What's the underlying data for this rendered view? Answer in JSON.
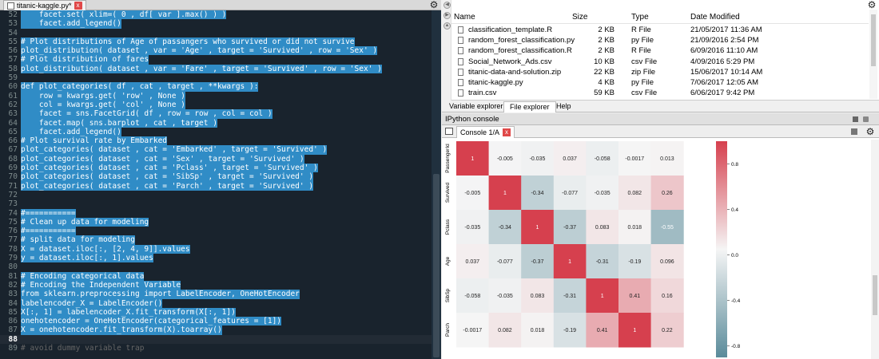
{
  "editor": {
    "tab_label": "titanic-kaggle.py*",
    "close_glyph": "x",
    "lines": [
      {
        "n": "52",
        "text": "    facet.set( xlim=( 0 , df[ var ].max() ) )",
        "sel": true
      },
      {
        "n": "53",
        "text": "    facet.add_legend()",
        "sel": true
      },
      {
        "n": "54",
        "text": "",
        "sel": true
      },
      {
        "n": "55",
        "text": "# Plot distributions of Age of passangers who survived or did not survive",
        "sel": true
      },
      {
        "n": "56",
        "text": "plot_distribution( dataset , var = 'Age' , target = 'Survived' , row = 'Sex' )",
        "sel": true
      },
      {
        "n": "57",
        "text": "# Plot distribution of fares",
        "sel": true
      },
      {
        "n": "58",
        "text": "plot_distribution( dataset , var = 'Fare' , target = 'Survived' , row = 'Sex' )",
        "sel": true
      },
      {
        "n": "59",
        "text": "",
        "sel": true
      },
      {
        "n": "60",
        "text": "def plot_categories( df , cat , target , **kwargs ):",
        "sel": true
      },
      {
        "n": "61",
        "text": "    row = kwargs.get( 'row' , None )",
        "sel": true
      },
      {
        "n": "62",
        "text": "    col = kwargs.get( 'col' , None )",
        "sel": true
      },
      {
        "n": "63",
        "text": "    facet = sns.FacetGrid( df , row = row , col = col )",
        "sel": true
      },
      {
        "n": "64",
        "text": "    facet.map( sns.barplot , cat , target )",
        "sel": true
      },
      {
        "n": "65",
        "text": "    facet.add_legend()",
        "sel": true
      },
      {
        "n": "66",
        "text": "# Plot survival rate by Embarked",
        "sel": true
      },
      {
        "n": "67",
        "text": "plot_categories( dataset , cat = 'Embarked' , target = 'Survived' )",
        "sel": true
      },
      {
        "n": "68",
        "text": "plot_categories( dataset , cat = 'Sex' , target = 'Survived' )",
        "sel": true
      },
      {
        "n": "69",
        "text": "plot_categories( dataset , cat = 'Pclass' , target = 'Survived' )",
        "sel": true
      },
      {
        "n": "70",
        "text": "plot_categories( dataset , cat = 'SibSp' , target = 'Survived' )",
        "sel": true
      },
      {
        "n": "71",
        "text": "plot_categories( dataset , cat = 'Parch' , target = 'Survived' )",
        "sel": true
      },
      {
        "n": "72",
        "text": "",
        "sel": true
      },
      {
        "n": "73",
        "text": "",
        "sel": true
      },
      {
        "n": "74",
        "text": "#===========",
        "sel": true
      },
      {
        "n": "75",
        "text": "# Clean up data for modeling",
        "sel": true
      },
      {
        "n": "76",
        "text": "#===========",
        "sel": true
      },
      {
        "n": "77",
        "text": "# split data for modeling",
        "sel": true
      },
      {
        "n": "78",
        "text": "X = dataset.iloc[:, [2, 4, 9]].values",
        "sel": true
      },
      {
        "n": "79",
        "text": "y = dataset.iloc[:, 1].values",
        "sel": true
      },
      {
        "n": "80",
        "text": "",
        "sel": true
      },
      {
        "n": "81",
        "text": "# Encoding categorical data",
        "sel": true
      },
      {
        "n": "82",
        "text": "# Encoding the Independent Variable",
        "sel": true
      },
      {
        "n": "83",
        "text": "from sklearn.preprocessing import LabelEncoder, OneHotEncoder",
        "sel": true
      },
      {
        "n": "84",
        "text": "labelencoder_X = LabelEncoder()",
        "sel": true
      },
      {
        "n": "85",
        "text": "X[:, 1] = labelencoder_X.fit_transform(X[:, 1])",
        "sel": true
      },
      {
        "n": "86",
        "text": "onehotencoder = OneHotEncoder(categorical_features = [1])",
        "sel": true
      },
      {
        "n": "87",
        "text": "X = onehotencoder.fit_transform(X).toarray()",
        "sel": true
      },
      {
        "n": "88",
        "text": "",
        "sel": false,
        "current": true
      },
      {
        "n": "89",
        "text": "# avoid dummy variable trap",
        "sel": false
      }
    ]
  },
  "file_explorer": {
    "columns": {
      "name": "Name",
      "size": "Size",
      "type": "Type",
      "modified": "Date Modified"
    },
    "files": [
      {
        "name": "classification_template.R",
        "size": "2 KB",
        "type": "R File",
        "modified": "21/05/2017 11:36 AM"
      },
      {
        "name": "random_forest_classification.py",
        "size": "2 KB",
        "type": "py File",
        "modified": "21/09/2016 2:54 PM"
      },
      {
        "name": "random_forest_classification.R",
        "size": "2 KB",
        "type": "R File",
        "modified": "6/09/2016 11:10 AM"
      },
      {
        "name": "Social_Network_Ads.csv",
        "size": "10 KB",
        "type": "csv File",
        "modified": "4/09/2016 5:29 PM"
      },
      {
        "name": "titanic-data-and-solution.zip",
        "size": "22 KB",
        "type": "zip File",
        "modified": "15/06/2017 10:14 AM"
      },
      {
        "name": "titanic-kaggle.py",
        "size": "4 KB",
        "type": "py File",
        "modified": "7/06/2017 12:05 AM"
      },
      {
        "name": "train.csv",
        "size": "59 KB",
        "type": "csv File",
        "modified": "6/06/2017 9:42 PM"
      }
    ]
  },
  "pane_tabs": [
    "Variable explorer",
    "File explorer",
    "Help"
  ],
  "console": {
    "title": "IPython console",
    "tab_label": "Console 1/A",
    "close_glyph": "x"
  },
  "chart_data": {
    "type": "heatmap",
    "row_labels": [
      "PassengerId",
      "Survived",
      "Pclass",
      "Age",
      "SibSp",
      "Parch"
    ],
    "values": [
      [
        "1",
        "-0.005",
        "-0.035",
        "0.037",
        "-0.058",
        "-0.0017",
        "0.013"
      ],
      [
        "-0.005",
        "1",
        "-0.34",
        "-0.077",
        "-0.035",
        "0.082",
        "0.26"
      ],
      [
        "-0.035",
        "-0.34",
        "1",
        "-0.37",
        "0.083",
        "0.018",
        "-0.55"
      ],
      [
        "0.037",
        "-0.077",
        "-0.37",
        "1",
        "-0.31",
        "-0.19",
        "0.096"
      ],
      [
        "-0.058",
        "-0.035",
        "0.083",
        "-0.31",
        "1",
        "0.41",
        "0.16"
      ],
      [
        "-0.0017",
        "0.082",
        "0.018",
        "-0.19",
        "0.41",
        "1",
        "0.22"
      ]
    ],
    "colorbar_ticks": [
      "0.8",
      "0.4",
      "0.0",
      "-0.4",
      "-0.8"
    ],
    "color_low": "#5a8b9a",
    "color_mid": "#f5f5f5",
    "color_high": "#d6404e"
  }
}
